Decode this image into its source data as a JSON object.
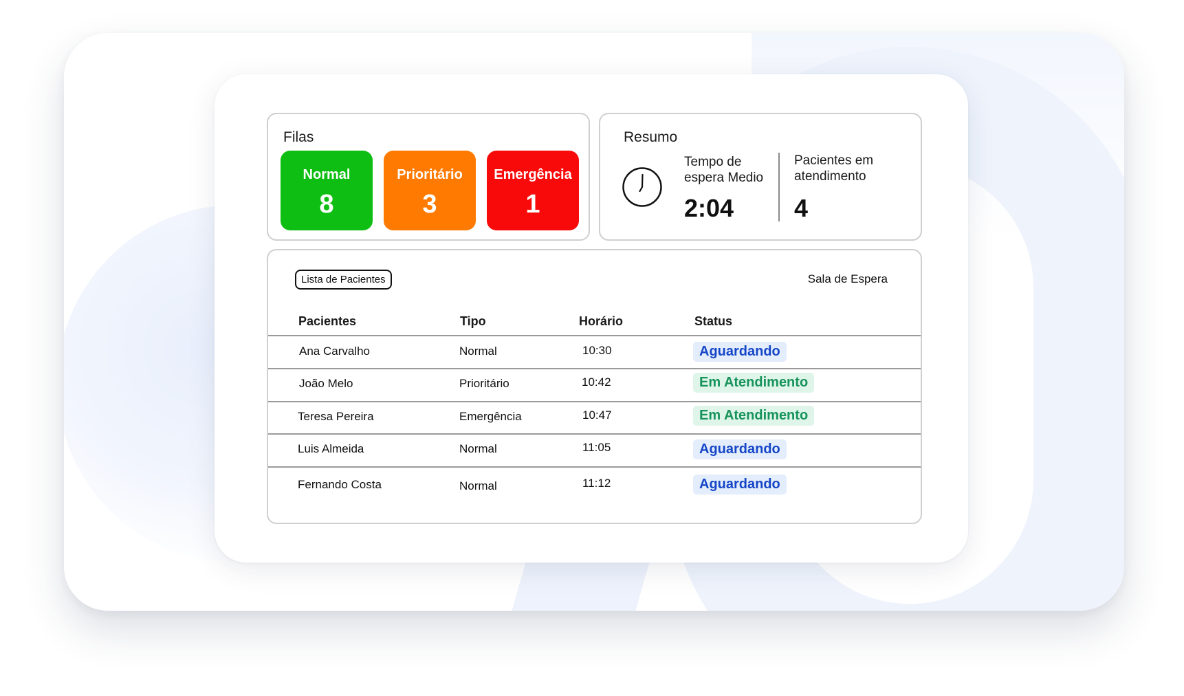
{
  "filas": {
    "title": "Filas",
    "queues": [
      {
        "label": "Normal",
        "count": "8",
        "color": "#0fbe12"
      },
      {
        "label": "Prioritário",
        "count": "3",
        "color": "#ff7a00"
      },
      {
        "label": "Emergência",
        "count": "1",
        "color": "#f80a0a"
      }
    ]
  },
  "resumo": {
    "title": "Resumo",
    "wait_label": "Tempo de espera Medio",
    "wait_value": "2:04",
    "patients_label": "Pacientes em atendimento",
    "patients_value": "4"
  },
  "lista": {
    "tab_label": "Lista de Pacientes",
    "room_label": "Sala de Espera",
    "columns": [
      "Pacientes",
      "Tipo",
      "Horário",
      "Status"
    ],
    "rows": [
      {
        "name": "Ana Carvalho",
        "type": "Normal",
        "time": "10:30",
        "status": "Aguardando"
      },
      {
        "name": "João Melo",
        "type": "Prioritário",
        "time": "10:42",
        "status": "Em Atendimento"
      },
      {
        "name": "Teresa Pereira",
        "type": "Emergência",
        "time": "10:47",
        "status": "Em Atendimento"
      },
      {
        "name": "Luis Almeida",
        "type": "Normal",
        "time": "11:05",
        "status": "Aguardando"
      },
      {
        "name": "Fernando Costa",
        "type": "Normal",
        "time": "11:12",
        "status": "Aguardando"
      }
    ]
  },
  "status_colors": {
    "Aguardando": {
      "bg": "#e3edfb",
      "fg": "#1646c8"
    },
    "Em Atendimento": {
      "bg": "#dff5ea",
      "fg": "#16935a"
    }
  }
}
